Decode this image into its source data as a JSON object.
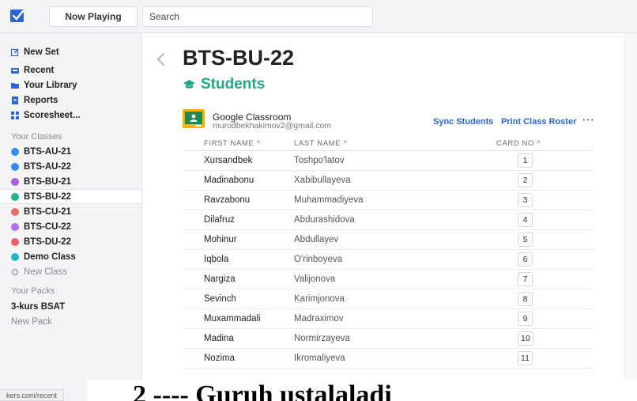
{
  "topbar": {
    "now_playing": "Now Playing",
    "search_placeholder": "Search"
  },
  "sidebar": {
    "menu": [
      {
        "label": "New Set",
        "icon": "edit-icon"
      },
      {
        "label": "Recent",
        "icon": "inbox-icon"
      },
      {
        "label": "Your Library",
        "icon": "folder-icon"
      },
      {
        "label": "Reports",
        "icon": "document-icon"
      },
      {
        "label": "Scoresheet...",
        "icon": "grid-icon"
      }
    ],
    "classes_label": "Your Classes",
    "classes": [
      {
        "label": "BTS-AU-21",
        "color": "#2e8cf0"
      },
      {
        "label": "BTS-AU-22",
        "color": "#2e8cf0"
      },
      {
        "label": "BTS-BU-21",
        "color": "#a463e0"
      },
      {
        "label": "BTS-BU-22",
        "color": "#21b48a",
        "selected": true
      },
      {
        "label": "BTS-CU-21",
        "color": "#f06a6a"
      },
      {
        "label": "BTS-CU-22",
        "color": "#b56ae6"
      },
      {
        "label": "BTS-DU-22",
        "color": "#f05a6a"
      },
      {
        "label": "Demo Class",
        "color": "#1eb6c8"
      }
    ],
    "new_class": "New Class",
    "packs_label": "Your Packs",
    "packs": [
      "3-kurs BSAT"
    ],
    "new_pack": "New Pack",
    "status_url": "kers.com/recent"
  },
  "main": {
    "class_title": "BTS-BU-22",
    "students_heading": "Students",
    "google": {
      "title": "Google Classroom",
      "email": "murodbekhakimov2@gmail.com"
    },
    "sync_students": "Sync Students",
    "print_roster": "Print Class Roster",
    "more": "···",
    "columns": {
      "first_name": "FIRST NAME ^",
      "last_name": "LAST NAME ^",
      "card_no": "CARD NO ^"
    },
    "students": [
      {
        "first": "Xursandbek",
        "last": "Toshpo'latov",
        "card": "1"
      },
      {
        "first": "Madinabonu",
        "last": "Xabibullayeva",
        "card": "2"
      },
      {
        "first": "Ravzabonu",
        "last": "Muhammadiyeva",
        "card": "3"
      },
      {
        "first": "Dilafruz",
        "last": "Abdurashidova",
        "card": "4"
      },
      {
        "first": "Mohinur",
        "last": "Abdullayev",
        "card": "5"
      },
      {
        "first": "Iqbola",
        "last": "O'rinboyeva",
        "card": "6"
      },
      {
        "first": "Nargiza",
        "last": "Valijonova",
        "card": "7"
      },
      {
        "first": "Sevinch",
        "last": "Karimjonova",
        "card": "8"
      },
      {
        "first": "Muxammadali",
        "last": "Madraximov",
        "card": "9"
      },
      {
        "first": "Madina",
        "last": "Normirzayeva",
        "card": "10"
      },
      {
        "first": "Nozima",
        "last": "Ikromaliyeva",
        "card": "11"
      }
    ]
  },
  "overlay": {
    "text": "2 ---- Guruh ustalaladi"
  },
  "colors": {
    "accent_green": "#21a884",
    "link_blue": "#2a64d6"
  }
}
